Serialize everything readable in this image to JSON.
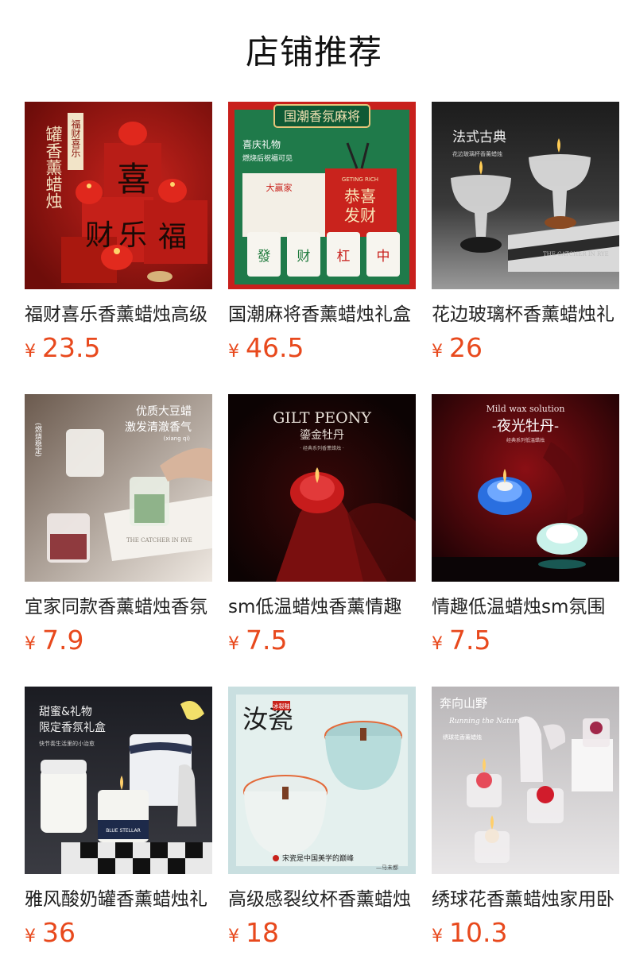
{
  "header": {
    "title": "店铺推荐"
  },
  "currency_symbol": "¥",
  "products": [
    {
      "name": "福财喜乐香薰蜡烛高级",
      "price": "23.5",
      "image_text": {
        "vertical": "罐香薰蜡烛",
        "tag": "福财喜乐",
        "c1": "喜",
        "c2": "财",
        "c3": "乐",
        "c4": "福"
      }
    },
    {
      "name": "国潮麻将香薰蜡烛礼盒",
      "price": "46.5",
      "image_text": {
        "banner": "国潮香氛麻将",
        "line1": "喜庆礼物",
        "line2": "燃烧后祝福可见",
        "box1": "大赢家",
        "box2": "GETING RICH",
        "box3": "恭喜",
        "box4": "发财",
        "t1": "發",
        "t2": "财",
        "t3": "杠",
        "t4": "中"
      }
    },
    {
      "name": "花边玻璃杯香薰蜡烛礼",
      "price": "26",
      "image_text": {
        "title": "法式古典",
        "sub": "花边玻璃杯香薰蜡烛",
        "book": "THE CATCHER IN RYE"
      }
    },
    {
      "name": "宜家同款香薰蜡烛香氛",
      "price": "7.9",
      "image_text": {
        "l1": "优质大豆蜡",
        "l2": "激发清澈香气",
        "l3": "(xiang qi)",
        "side": "(燃烧稳定)",
        "book": "THE CATCHER IN RYE"
      }
    },
    {
      "name": "sm低温蜡烛香薰情趣",
      "price": "7.5",
      "image_text": {
        "en": "GILT PEONY",
        "cn": "鎏金牡丹",
        "sub": "· 经典系列香薰蜡烛 ·"
      }
    },
    {
      "name": "情趣低温蜡烛sm氛围",
      "price": "7.5",
      "image_text": {
        "en": "Mild wax solution",
        "cn": "-夜光牡丹-",
        "sub": "经典系列低温蜡烛"
      }
    },
    {
      "name": "雅风酸奶罐香薰蜡烛礼",
      "price": "36",
      "image_text": {
        "l1": "甜蜜&礼物",
        "l2": "限定香氛礼盒",
        "l3": "快节奏生活里的小治愈",
        "jar": "BLUE STELLAR"
      }
    },
    {
      "name": "高级感裂纹杯香薰蜡烛",
      "price": "18",
      "image_text": {
        "big": "汝瓷",
        "tag": "冰裂釉",
        "quote": "宋瓷是中国美学的巅峰",
        "author": "—马未都"
      }
    },
    {
      "name": "绣球花香薰蜡烛家用卧",
      "price": "10.3",
      "image_text": {
        "cn": "奔向山野",
        "en": "Running the Nature",
        "sub": "绣球花香薰蜡烛"
      }
    }
  ]
}
